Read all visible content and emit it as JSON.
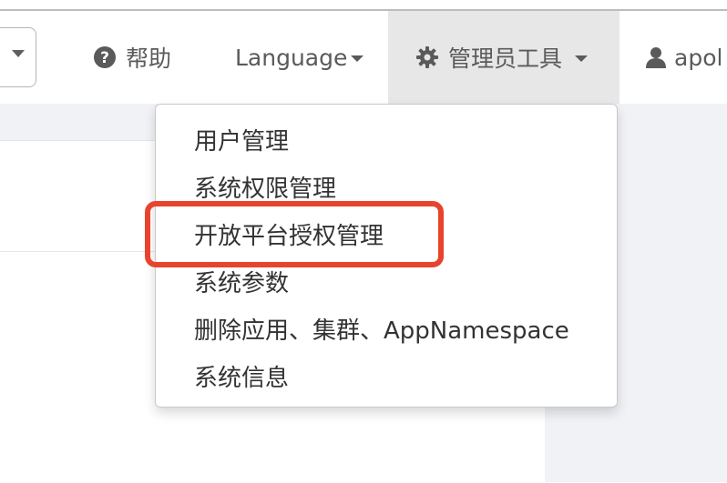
{
  "navbar": {
    "help": {
      "label": "帮助",
      "icon": "question-circle-icon"
    },
    "language": {
      "label": "Language",
      "icon": "caret-down-icon"
    },
    "admin_tools": {
      "label": "管理员工具",
      "icon": "gear-icon"
    },
    "user": {
      "label": "apol",
      "icon": "user-icon"
    }
  },
  "admin_menu": {
    "items": [
      {
        "label": "用户管理"
      },
      {
        "label": "系统权限管理"
      },
      {
        "label": "开放平台授权管理"
      },
      {
        "label": "系统参数"
      },
      {
        "label": "删除应用、集群、AppNamespace"
      },
      {
        "label": "系统信息"
      }
    ],
    "highlighted_index": 2
  },
  "colors": {
    "highlight": "#e8432d",
    "nav_text": "#5a5a5a",
    "admin_bg": "#e7e7e7",
    "page_bg": "#f0f2f6"
  }
}
